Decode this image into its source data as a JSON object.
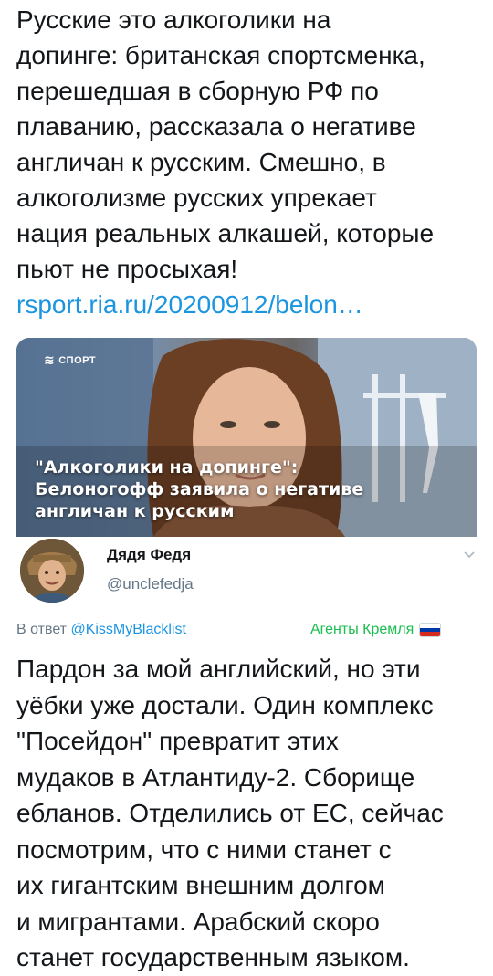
{
  "quoted_tweet": {
    "text": "Русские это алкоголики на\nдопинге: британская спортсменка,\nперешедшая в сборную РФ по\nплаванию, рассказала о негативе\nангличан к русским. Смешно, в\nалкоголизме русских упрекает\nнация реальных алкашей, которые\nпьют не просыхая!",
    "link": "rsport.ria.ru/20200912/belon…"
  },
  "media_card": {
    "logo_text": "СПОРТ",
    "logo_icon": "sport-logo-icon",
    "caption": "\"Алкоголики на допинге\":\nБелоногофф заявила о негативе\nангличан к русским"
  },
  "author": {
    "name": "Дядя Федя",
    "handle": "@unclefedja",
    "avatar_icon": "avatar-icon",
    "menu_icon": "chevron-down-icon"
  },
  "reply": {
    "prefix": "В ответ ",
    "to_handle": "@KissMyBlacklist",
    "label": "Агенты Кремля",
    "label_color": "#19bf4f",
    "flag_icon": "russian-flag-icon",
    "flag_colors": [
      "#ffffff",
      "#0039a6",
      "#d52b1e"
    ]
  },
  "tweet": {
    "text": "Пардон за мой английский, но эти\nуёбки уже достали. Один комплекс\n\"Посейдон\" превратит этих\nмудаков в Атлантиду-2. Сборище\nебланов. Отделились от ЕС, сейчас\nпосмотрим, что с ними станет с\nих гигантским внешним долгом\nи мигрантами. Арабский скоро\nстанет государственным языком."
  },
  "colors": {
    "text": "#14171a",
    "link": "#1b95e0",
    "secondary": "#657786"
  }
}
